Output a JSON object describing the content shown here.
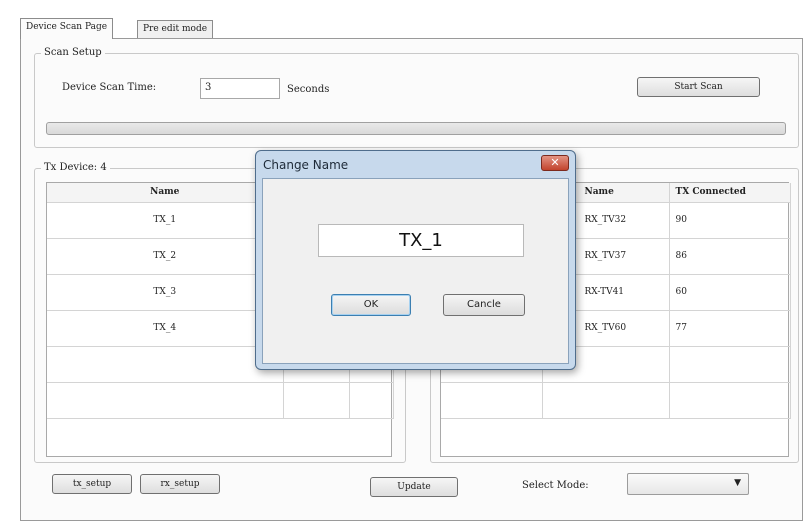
{
  "tabs": [
    {
      "label": "Device Scan Page",
      "active": true
    },
    {
      "label": "Pre edit mode",
      "active": false
    }
  ],
  "scan_setup": {
    "title": "Scan Setup",
    "scan_time_label": "Device Scan Time:",
    "scan_time_value": "3",
    "seconds_label": "Seconds",
    "start_button": "Start Scan",
    "progress": 0
  },
  "tx": {
    "title": "Tx Device: 4",
    "columns": [
      "Name"
    ],
    "rows": [
      "TX_1",
      "TX_2",
      "TX_3",
      "TX_4"
    ]
  },
  "rx": {
    "columns": [
      "Name",
      "TX Connected"
    ],
    "rows": [
      {
        "name": "RX_TV32",
        "tx": "90"
      },
      {
        "name": "RX_TV37",
        "tx": "86"
      },
      {
        "name": "RX-TV41",
        "tx": "60"
      },
      {
        "name": "RX_TV60",
        "tx": "77"
      }
    ]
  },
  "bottom": {
    "tx_setup": "tx_setup",
    "rx_setup": "rx_setup",
    "update": "Update",
    "select_mode_label": "Select Mode:",
    "select_mode_value": ""
  },
  "dialog": {
    "title": "Change Name",
    "value": "TX_1",
    "ok": "OK",
    "cancel": "Cancle"
  },
  "icons": {
    "close": "close-icon",
    "dropdown": "chevron-down-icon"
  }
}
